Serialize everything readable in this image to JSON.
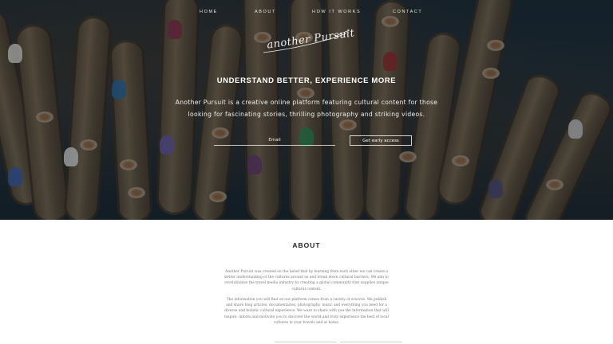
{
  "nav": {
    "items": [
      "HOME",
      "ABOUT",
      "HOW IT WORKS",
      "CONTACT"
    ]
  },
  "logo": {
    "text": "another Pursuit"
  },
  "hero": {
    "title": "UNDERSTAND BETTER, EXPERIENCE MORE",
    "subtitle": "Another Pursuit is a creative online platform featuring cultural content for those looking for fascinating stories, thrilling photography and striking videos.",
    "email_placeholder": "Email",
    "cta_label": "Get early access"
  },
  "about": {
    "title": "ABOUT",
    "paragraph1": "Another Pursuit was created on the belief that by learning from each other we can create a better understanding of the cultures around us and break down cultural barriers. We aim to revolutionise the travel media industry by creating a global community that supplies unique cultural content.",
    "paragraph2": "The information you will find on our platform comes from a variety of sources. We publish and share blog articles, documentaries, photography, music and everything you need for a diverse and holistic cultural experience. We want to share with you the information that will inspire, inform and motivate you to discover the world and truly experience the best of local cultures in your travels and at home."
  }
}
